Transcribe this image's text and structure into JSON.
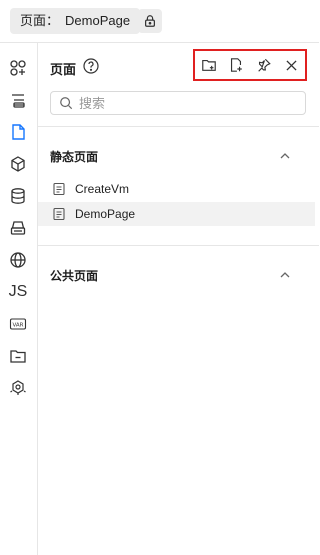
{
  "breadcrumb": {
    "label": "页面：",
    "page": "DemoPage"
  },
  "rail": {
    "items": [
      {
        "name": "components-icon"
      },
      {
        "name": "outline-icon"
      },
      {
        "name": "pages-icon",
        "active": true
      },
      {
        "name": "blocks-icon"
      },
      {
        "name": "datasource-icon"
      },
      {
        "name": "print-icon"
      },
      {
        "name": "globe-icon"
      },
      {
        "name": "js-icon",
        "text": "JS"
      },
      {
        "name": "variables-icon",
        "text": "VAR"
      },
      {
        "name": "folder-minus-icon"
      },
      {
        "name": "plugins-icon"
      }
    ]
  },
  "panel": {
    "title": "页面",
    "search_placeholder": "搜索",
    "static_section": {
      "title": "静态页面",
      "items": [
        "CreateVm",
        "DemoPage"
      ]
    },
    "public_section": {
      "title": "公共页面"
    }
  },
  "colors": {
    "highlight_border": "#e02020",
    "active_icon": "#1677ff"
  }
}
